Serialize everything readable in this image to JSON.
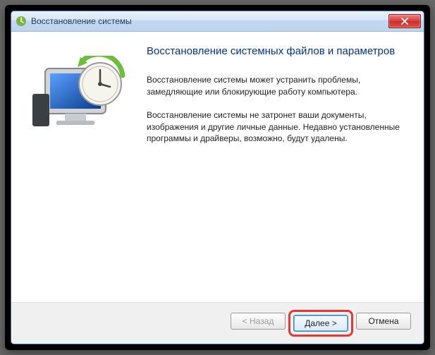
{
  "titlebar": {
    "title": "Восстановление системы"
  },
  "content": {
    "heading": "Восстановление системных файлов и параметров",
    "para1": "Восстановление системы может устранить проблемы, замедляющие или блокирующие работу компьютера.",
    "para2": "Восстановление системы не затронет ваши документы, изображения и другие личные данные. Недавно установленные программы и драйверы, возможно, будут удалены."
  },
  "footer": {
    "back": "< Назад",
    "next": "Далее >",
    "cancel": "Отмена"
  }
}
